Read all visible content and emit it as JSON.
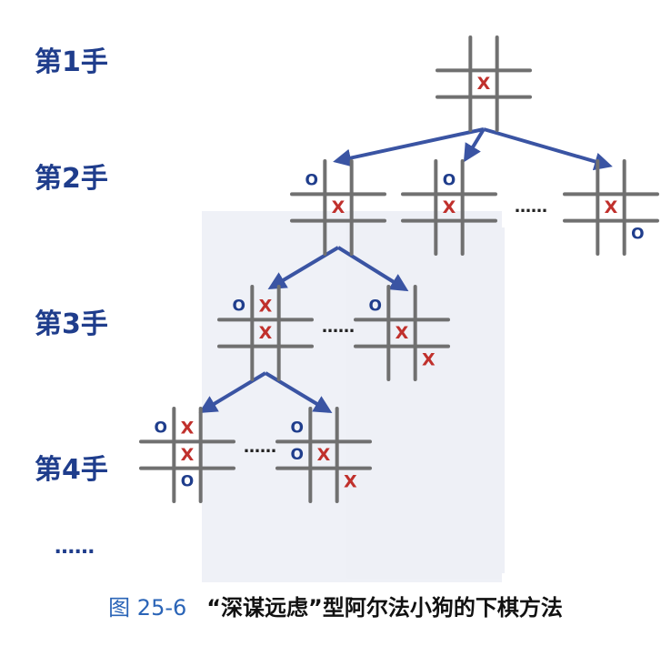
{
  "move_labels": [
    "第1手",
    "第2手",
    "第3手",
    "第4手"
  ],
  "bottom_ellipsis": "……",
  "inline_ellipsis": "……",
  "marks": {
    "x": "X",
    "o": "O"
  },
  "colors": {
    "x_mark": "#c0302c",
    "o_mark": "#1f3d8c",
    "arrow": "#3a54a3",
    "grid": "#707070",
    "caption_number": "#2a64b7"
  },
  "caption": {
    "number": "图 25-6",
    "title": "“深谋远虑”型阿尔法小狗的下棋方法"
  },
  "boards": [
    {
      "id": "move1",
      "cells": [
        "",
        "",
        "",
        "",
        "X",
        "",
        "",
        "",
        ""
      ]
    },
    {
      "id": "move2-a",
      "cells": [
        "O",
        "",
        "",
        "",
        "X",
        "",
        "",
        "",
        ""
      ]
    },
    {
      "id": "move2-b",
      "cells": [
        "",
        "O",
        "",
        "",
        "X",
        "",
        "",
        "",
        ""
      ]
    },
    {
      "id": "move2-c",
      "cells": [
        "",
        "",
        "",
        "",
        "X",
        "",
        "",
        "",
        "O"
      ]
    },
    {
      "id": "move3-a",
      "cells": [
        "O",
        "X",
        "",
        "",
        "X",
        "",
        "",
        "",
        ""
      ]
    },
    {
      "id": "move3-b",
      "cells": [
        "O",
        "",
        "",
        "",
        "X",
        "",
        "",
        "",
        "X"
      ]
    },
    {
      "id": "move4-a",
      "cells": [
        "O",
        "X",
        "",
        "",
        "X",
        "",
        "",
        "O",
        ""
      ]
    },
    {
      "id": "move4-b",
      "cells": [
        "O",
        "",
        "",
        "O",
        "X",
        "",
        "",
        "",
        "X"
      ]
    }
  ]
}
